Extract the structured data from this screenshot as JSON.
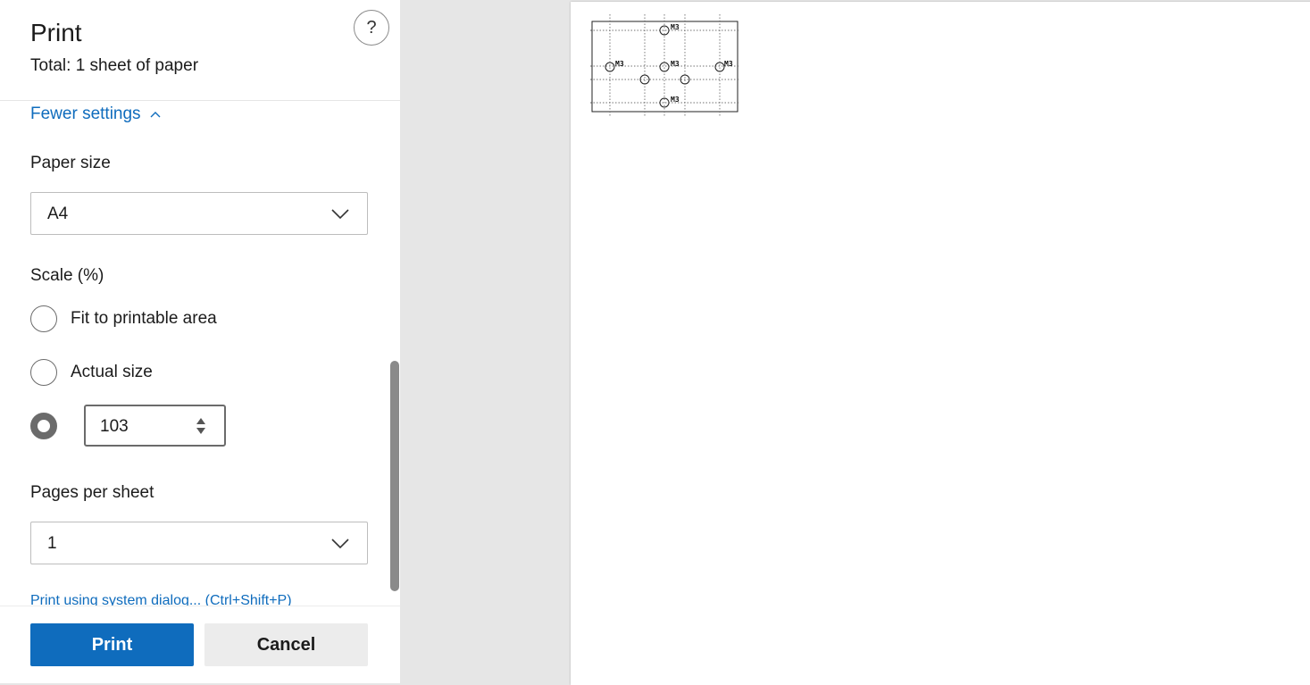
{
  "header": {
    "title": "Print",
    "subtitle": "Total: 1 sheet of paper",
    "help_label": "?"
  },
  "settings": {
    "fewer_settings_label": "Fewer settings",
    "paper_size": {
      "label": "Paper size",
      "value": "A4"
    },
    "scale": {
      "label": "Scale (%)",
      "options": [
        {
          "label": "Fit to printable area",
          "checked": false
        },
        {
          "label": "Actual size",
          "checked": false
        },
        {
          "label": "",
          "checked": true
        }
      ],
      "custom_value": "103"
    },
    "pages_per_sheet": {
      "label": "Pages per sheet",
      "value": "1"
    },
    "system_dialog_link": "Print using system dialog... (Ctrl+Shift+P)"
  },
  "footer": {
    "print_label": "Print",
    "cancel_label": "Cancel"
  },
  "preview": {
    "hole_labels": [
      "M3",
      "M3",
      "M3",
      "M3",
      "M3"
    ]
  },
  "colors": {
    "accent": "#0f6cbd",
    "panel_bg": "#ffffff",
    "preview_bg": "#e6e6e6",
    "cancel_bg": "#ececec"
  },
  "icons": {
    "help": "question-icon",
    "collapse": "chevron-up-icon",
    "dropdown": "chevron-down-icon",
    "spinner": "spinner-arrows-icon"
  }
}
